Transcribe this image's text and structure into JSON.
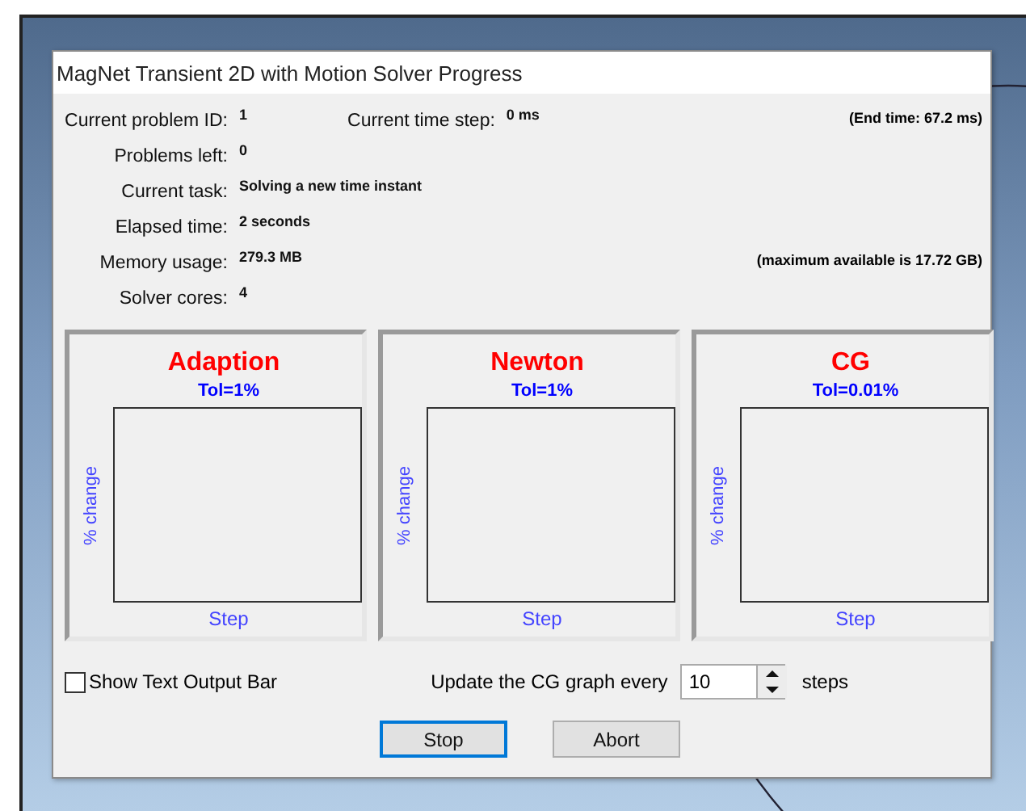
{
  "window": {
    "title": "MagNet Transient 2D with Motion Solver Progress"
  },
  "fields": [
    {
      "label": "Current problem ID:",
      "value": "1"
    },
    {
      "label": "Problems left:",
      "value": "0"
    },
    {
      "label": "Current task:",
      "value": "Solving a new time instant"
    },
    {
      "label": "Elapsed time:",
      "value": "2 seconds"
    },
    {
      "label": "Memory usage:",
      "value": "279.3 MB"
    },
    {
      "label": "Solver cores:",
      "value": "4"
    }
  ],
  "time_step": {
    "label": "Current time step:",
    "value": "0 ms"
  },
  "end_time": "(End time: 67.2 ms)",
  "memory_max": "(maximum available is 17.72 GB)",
  "graphs": [
    {
      "title": "Adaption",
      "tolerance": "Tol=1%",
      "ylabel": "% change",
      "xlabel": "Step"
    },
    {
      "title": "Newton",
      "tolerance": "Tol=1%",
      "ylabel": "% change",
      "xlabel": "Step"
    },
    {
      "title": "CG",
      "tolerance": "Tol=0.01%",
      "ylabel": "% change",
      "xlabel": "Step"
    }
  ],
  "show_output": {
    "label": "Show Text Output Bar",
    "checked": false
  },
  "update": {
    "label": "Update the CG graph every",
    "value": "10",
    "unit": "steps"
  },
  "buttons": [
    {
      "label": "Stop",
      "focused": true
    },
    {
      "label": "Abort",
      "focused": false
    }
  ]
}
